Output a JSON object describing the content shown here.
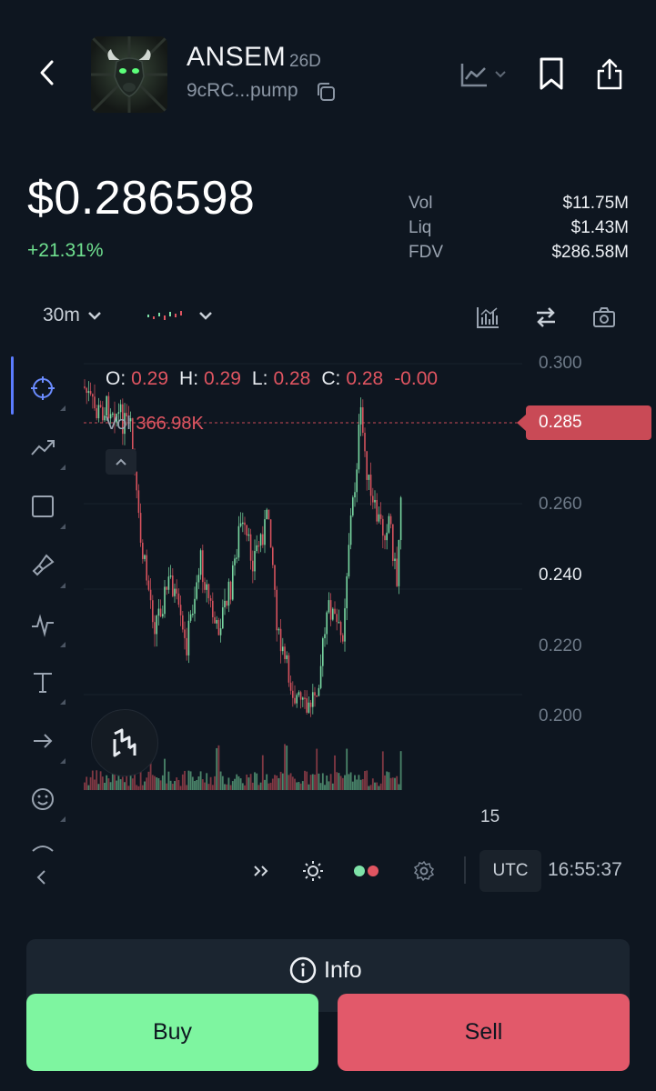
{
  "header": {
    "token_name": "ANSEM",
    "token_age": "26D",
    "token_address": "9cRC...pump"
  },
  "price": {
    "current": "$0.286598",
    "change": "+21.31%"
  },
  "stats": [
    {
      "label": "Vol",
      "value": "$11.75M"
    },
    {
      "label": "Liq",
      "value": "$1.43M"
    },
    {
      "label": "FDV",
      "value": "$286.58M"
    }
  ],
  "chart_toolbar": {
    "interval": "30m"
  },
  "chart": {
    "ohlc": {
      "o_label": "O:",
      "o": "0.29",
      "h_label": "H:",
      "h": "0.29",
      "l_label": "L:",
      "l": "0.28",
      "c_label": "C:",
      "c": "0.28",
      "change": "-0.00"
    },
    "volume_label": "Vol",
    "volume_value": "366.98K",
    "y_ticks": [
      "0.300",
      "0.260",
      "0.240",
      "0.220",
      "0.200"
    ],
    "current_price_tag": "0.285",
    "x_tick": "15"
  },
  "bottom_toolbar": {
    "timezone": "UTC",
    "clock": "16:55:37"
  },
  "actions": {
    "info_label": "Info",
    "buy_label": "Buy",
    "sell_label": "Sell"
  },
  "colors": {
    "up": "#7ee2a8",
    "down": "#e05561",
    "accent": "#5b7cff",
    "background": "#0e1620"
  },
  "icons": [
    "back-icon",
    "copy-icon",
    "line-chart-icon",
    "bookmark-icon",
    "share-icon",
    "indicators-icon",
    "swap-icon",
    "camera-icon",
    "crosshair-icon",
    "trend-line-icon",
    "rectangle-icon",
    "brush-icon",
    "wave-icon",
    "text-icon",
    "arrow-icon",
    "emoji-icon",
    "collapse-chevron-icon",
    "fast-forward-icon",
    "brightness-icon",
    "color-dots-icon",
    "settings-icon",
    "info-icon"
  ]
}
